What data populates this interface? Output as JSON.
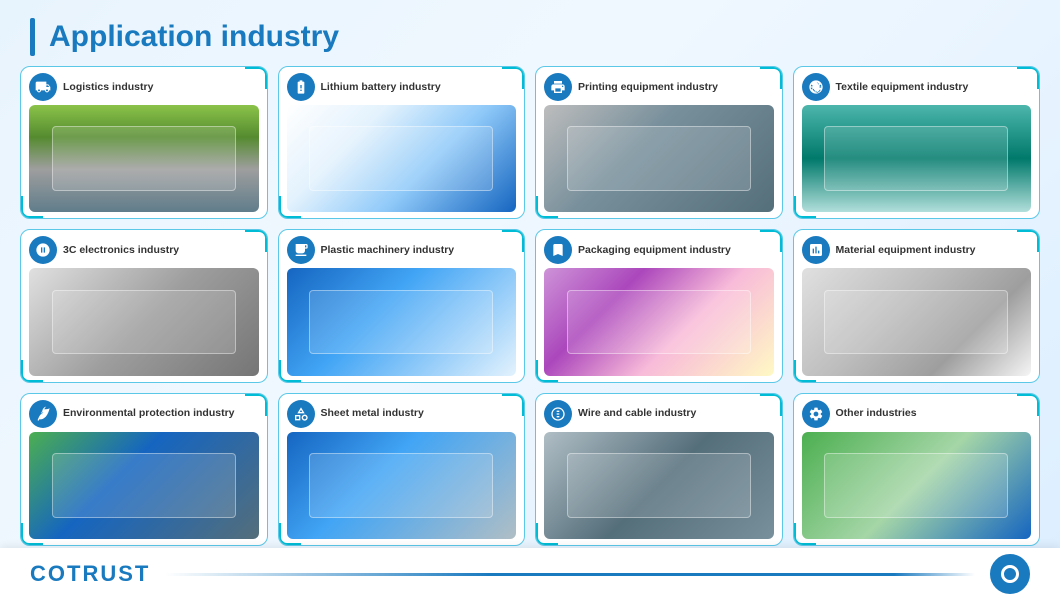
{
  "page": {
    "title": "Application industry",
    "logo": "COTRUST"
  },
  "cards": [
    {
      "id": "logistics",
      "title": "Logistics industry",
      "icon": "logistics-icon",
      "imgClass": "img-logistics"
    },
    {
      "id": "lithium",
      "title": "Lithium battery industry",
      "icon": "battery-icon",
      "imgClass": "img-lithium"
    },
    {
      "id": "printing",
      "title": "Printing equipment industry",
      "icon": "printing-icon",
      "imgClass": "img-printing"
    },
    {
      "id": "textile",
      "title": "Textile equipment industry",
      "icon": "textile-icon",
      "imgClass": "img-textile"
    },
    {
      "id": "3c",
      "title": "3C electronics industry",
      "icon": "electronics-icon",
      "imgClass": "img-3c"
    },
    {
      "id": "plastic",
      "title": "Plastic machinery industry",
      "icon": "plastic-icon",
      "imgClass": "img-plastic"
    },
    {
      "id": "packaging",
      "title": "Packaging equipment industry",
      "icon": "packaging-icon",
      "imgClass": "img-packaging"
    },
    {
      "id": "material",
      "title": "Material equipment industry",
      "icon": "material-icon",
      "imgClass": "img-material"
    },
    {
      "id": "environmental",
      "title": "Environmental protection industry",
      "icon": "env-icon",
      "imgClass": "img-environmental"
    },
    {
      "id": "sheetmetal",
      "title": "Sheet metal industry",
      "icon": "sheetmetal-icon",
      "imgClass": "img-sheetmetal"
    },
    {
      "id": "wire",
      "title": "Wire and cable industry",
      "icon": "wire-icon",
      "imgClass": "img-wire"
    },
    {
      "id": "other",
      "title": "Other industries",
      "icon": "other-icon",
      "imgClass": "img-other"
    }
  ]
}
